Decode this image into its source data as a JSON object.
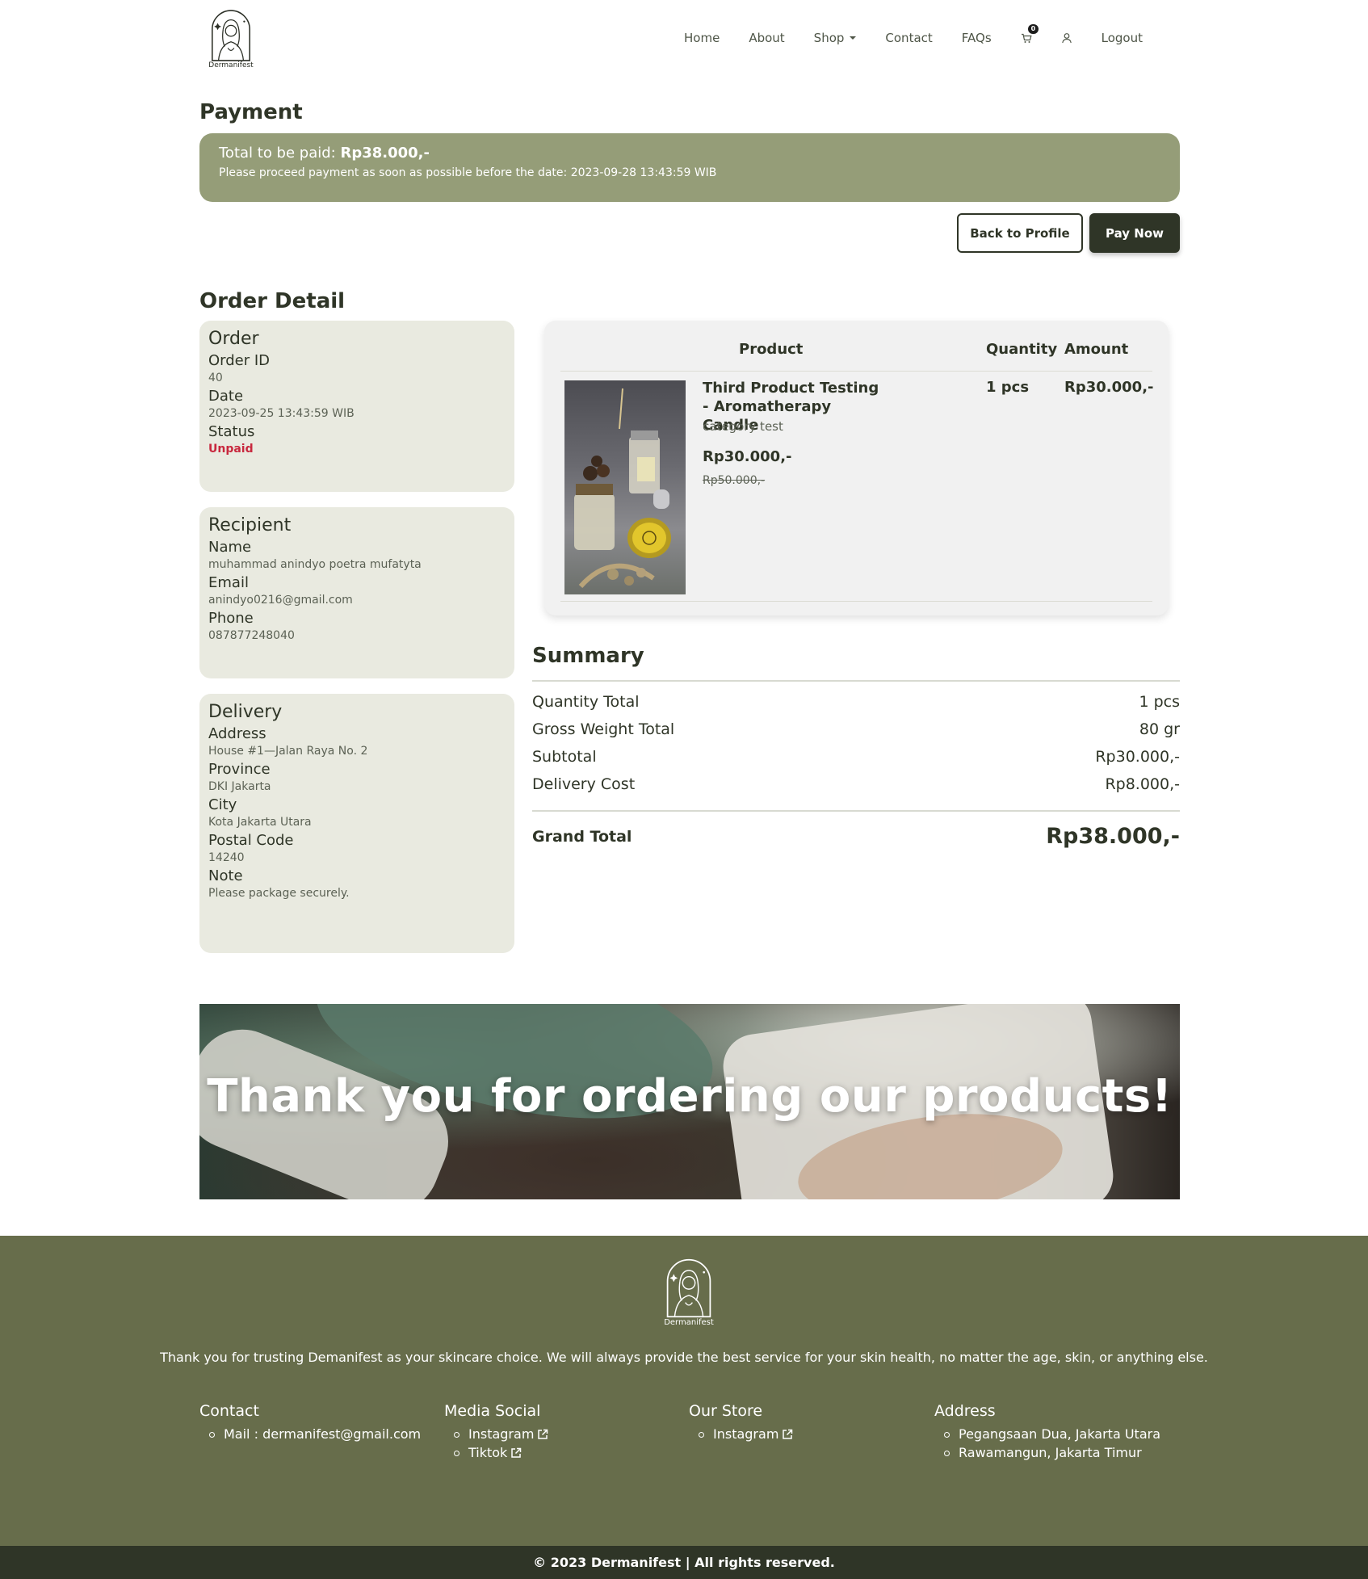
{
  "brand": {
    "name": "Dermanifest"
  },
  "nav": {
    "items": [
      "Home",
      "About",
      "Shop",
      "Contact",
      "FAQs"
    ],
    "cart_count": "0",
    "logout": "Logout",
    "cart_icon": "cart-icon",
    "user_icon": "user-icon"
  },
  "payment": {
    "heading": "Payment",
    "total_label": "Total to be paid:",
    "total_value": "Rp38.000,-",
    "note": "Please proceed payment as soon as possible before the date: 2023-09-28 13:43:59 WIB",
    "back_button": "Back to Profile",
    "pay_button": "Pay Now",
    "banner_color": "#959d78"
  },
  "order_detail": {
    "heading": "Order Detail",
    "order": {
      "title": "Order",
      "id_label": "Order ID",
      "id_value": "40",
      "date_label": "Date",
      "date_value": "2023-09-25 13:43:59 WIB",
      "status_label": "Status",
      "status_value": "Unpaid"
    },
    "recipient": {
      "title": "Recipient",
      "name_label": "Name",
      "name_value": "muhammad anindyo poetra mufatyta",
      "email_label": "Email",
      "email_value": "anindyo0216@gmail.com",
      "phone_label": "Phone",
      "phone_value": "087877248040"
    },
    "delivery": {
      "title": "Delivery",
      "address_label": "Address",
      "address_value": "House #1—Jalan Raya No. 2",
      "province_label": "Province",
      "province_value": "DKI Jakarta",
      "city_label": "City",
      "city_value": "Kota Jakarta Utara",
      "postal_label": "Postal Code",
      "postal_value": "14240",
      "note_label": "Note",
      "note_value": "Please package securely."
    }
  },
  "products": {
    "headers": {
      "product": "Product",
      "quantity": "Quantity",
      "amount": "Amount"
    },
    "items": [
      {
        "name": "Third Product Testing - Aromatherapy Candle",
        "category": "category test",
        "price": "Rp30.000,-",
        "old_price": "Rp50.000,-",
        "quantity": "1 pcs",
        "amount": "Rp30.000,-"
      }
    ]
  },
  "summary": {
    "heading": "Summary",
    "rows": [
      {
        "label": "Quantity Total",
        "value": "1 pcs"
      },
      {
        "label": "Gross Weight Total",
        "value": "80 gr"
      },
      {
        "label": "Subtotal",
        "value": "Rp30.000,-"
      },
      {
        "label": "Delivery Cost",
        "value": "Rp8.000,-"
      }
    ],
    "grand_label": "Grand Total",
    "grand_value": "Rp38.000,-"
  },
  "banner": {
    "text": "Thank you for ordering our products!"
  },
  "footer": {
    "tagline": "Thank you for trusting Demanifest as your skincare choice. We will always provide the best service for your skin health, no matter the age, skin, or anything else.",
    "contact": {
      "title": "Contact",
      "items": [
        "Mail : dermanifest@gmail.com"
      ]
    },
    "media": {
      "title": "Media Social",
      "items": [
        "Instagram",
        "Tiktok"
      ]
    },
    "store": {
      "title": "Our Store",
      "items": [
        "Instagram"
      ]
    },
    "address": {
      "title": "Address",
      "items": [
        "Pegangsaan Dua, Jakarta Utara",
        "Rawamangun, Jakarta Timur"
      ]
    },
    "copyright": "© 2023 Dermanifest | All rights reserved.",
    "bg_color": "#676d4b"
  }
}
